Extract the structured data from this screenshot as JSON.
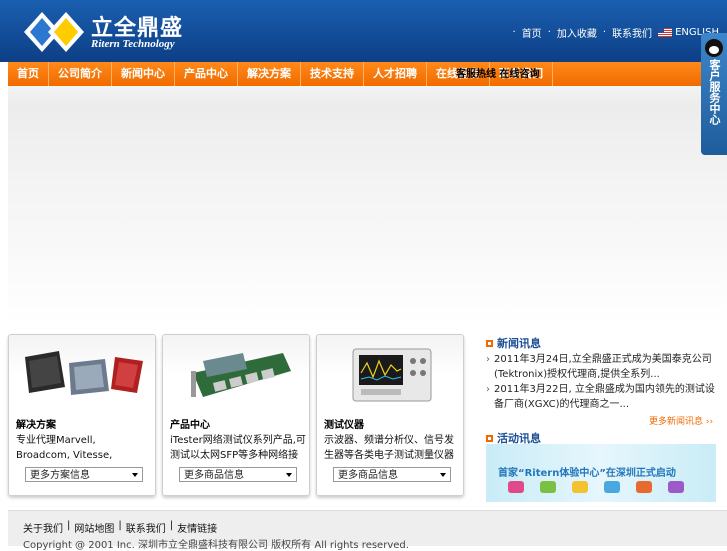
{
  "header": {
    "logo_cn": "立全鼎盛",
    "logo_en": "Ritern Technology",
    "toplinks": [
      "首页",
      "加入收藏",
      "联系我们"
    ],
    "english_label": "ENGLISH"
  },
  "nav": {
    "items": [
      "首页",
      "公司简介",
      "新闻中心",
      "产品中心",
      "解决方案",
      "技术支持",
      "人才招聘",
      "在线留言",
      "联系我们"
    ],
    "extra": "客服热线 在线咨询"
  },
  "service_tab": {
    "label": "客户服务中心"
  },
  "cards": [
    {
      "title": "解决方案",
      "desc": "专业代理Marvell, Broadcom, Vitesse, Atheros, Realtek, IC+",
      "select": "更多方案信息"
    },
    {
      "title": "产品中心",
      "desc": "iTester网络测试仪系列产品,可测试以太网SFP等多种网络接口",
      "select": "更多商品信息"
    },
    {
      "title": "测试仪器",
      "desc": "示波器、频谱分析仪、信号发生器等各类电子测试测量仪器",
      "select": "更多商品信息"
    }
  ],
  "news": {
    "title": "新闻讯息",
    "items": [
      "2011年3月24日,立全鼎盛正式成为美国泰克公司(Tektronix)授权代理商,提供全系列...",
      "2011年3月22日, 立全鼎盛成为国内领先的测试设备厂商(XGXC)的代理商之一..."
    ],
    "more": "更多新闻讯息 ››"
  },
  "activity": {
    "title": "活动讯息",
    "promo_text": "首家“Ritern体验中心”在深圳正式启动"
  },
  "footer": {
    "links": [
      "关于我们",
      "网站地图",
      "联系我们",
      "友情链接"
    ],
    "copyright": "Copyright @ 2001 Inc. 深圳市立全鼎盛科技有限公司 版权所有 All rights reserved."
  },
  "colors": {
    "header_blue": "#0d3f86",
    "nav_orange": "#f06a00",
    "accent_blue": "#1b4e96"
  }
}
